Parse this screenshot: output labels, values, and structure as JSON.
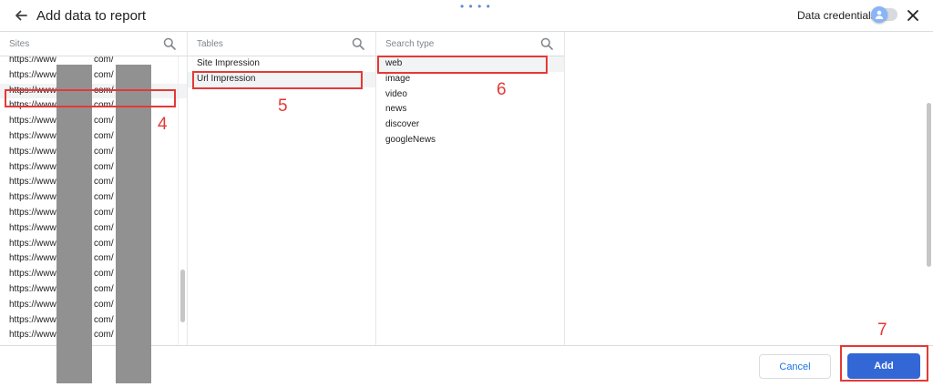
{
  "header": {
    "title": "Add data to report",
    "drag_handle": "• • • •",
    "credentials_label": "Data credentials:",
    "credentials_toggle_on": false
  },
  "columns": {
    "sites": {
      "label": "Sites",
      "items": [
        {
          "prefix": "https://www",
          "suffix": "com/"
        },
        {
          "prefix": "https://www",
          "suffix": "com/"
        },
        {
          "prefix": "https://www",
          "suffix": "com/"
        },
        {
          "prefix": "https://www",
          "suffix": "com/"
        },
        {
          "prefix": "https://www",
          "suffix": "com/"
        },
        {
          "prefix": "https://www",
          "suffix": "com/"
        },
        {
          "prefix": "https://www",
          "suffix": "com/"
        },
        {
          "prefix": "https://www",
          "suffix": "com/"
        },
        {
          "prefix": "https://www",
          "suffix": "com/"
        },
        {
          "prefix": "https://www",
          "suffix": "com/"
        },
        {
          "prefix": "https://www",
          "suffix": "com/"
        },
        {
          "prefix": "https://www",
          "suffix": "com/"
        },
        {
          "prefix": "https://www",
          "suffix": "com/"
        },
        {
          "prefix": "https://www",
          "suffix": "com/"
        },
        {
          "prefix": "https://www",
          "suffix": "com/"
        },
        {
          "prefix": "https://www",
          "suffix": "com/"
        },
        {
          "prefix": "https://www",
          "suffix": "com/"
        },
        {
          "prefix": "https://www",
          "suffix": "com/"
        },
        {
          "prefix": "https://www",
          "suffix": "com/"
        }
      ]
    },
    "tables": {
      "label": "Tables",
      "items": [
        "Site Impression",
        "Url Impression"
      ]
    },
    "search_type": {
      "label": "Search type",
      "items": [
        "web",
        "image",
        "video",
        "news",
        "discover",
        "googleNews"
      ]
    }
  },
  "annotations": [
    "4",
    "5",
    "6",
    "7"
  ],
  "footer": {
    "cancel_label": "Cancel",
    "add_label": "Add"
  },
  "colors": {
    "accent": "#3367d6",
    "annotation": "#e53935",
    "selected_row": "#f1f3f4"
  }
}
